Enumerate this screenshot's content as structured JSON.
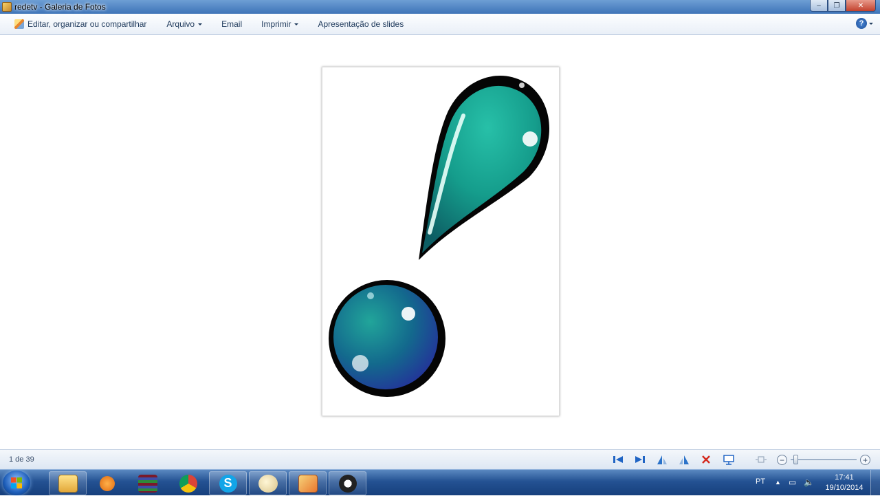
{
  "window": {
    "title": "redetv - Galeria de Fotos",
    "controls": {
      "minimize": "‒",
      "maximize": "❐",
      "close": "✕"
    }
  },
  "menu": {
    "items": [
      {
        "label": "Editar, organizar ou compartilhar",
        "icon": "edit-organize-icon"
      },
      {
        "label": "Arquivo",
        "dropdown": true
      },
      {
        "label": "Email"
      },
      {
        "label": "Imprimir",
        "dropdown": true
      },
      {
        "label": "Apresentação de slides"
      }
    ],
    "help_icon": "help-icon",
    "help_glyph": "?"
  },
  "photo": {
    "subject": "exclamation-mark-logo",
    "colors": {
      "teal": "#1aa091",
      "deep_blue": "#1f3f9a",
      "outline": "#050505"
    }
  },
  "navbar": {
    "counter": "1 de 39",
    "buttons": [
      "previous-icon",
      "next-icon",
      "rotate-left-icon",
      "rotate-right-icon",
      "delete-icon",
      "slideshow-icon",
      "actual-size-icon",
      "zoom-out-icon",
      "zoom-in-icon"
    ],
    "zoom_minus": "−",
    "zoom_plus": "+",
    "zoom_level": 0.05
  },
  "taskbar": {
    "apps": [
      "windows-explorer-icon",
      "media-player-icon",
      "winrar-icon",
      "chrome-icon",
      "skype-icon",
      "paint-icon",
      "photo-gallery-icon",
      "movie-maker-icon"
    ],
    "language": "PT",
    "time": "17:41",
    "date": "19/10/2014"
  }
}
